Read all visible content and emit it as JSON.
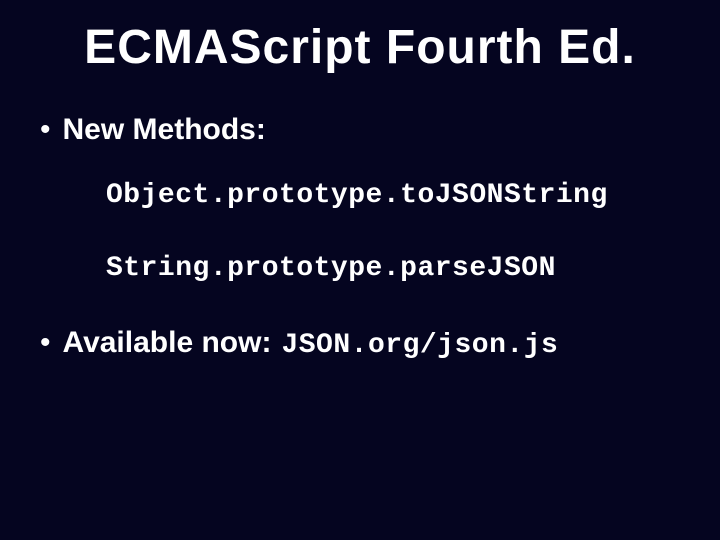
{
  "title": "ECMAScript Fourth Ed.",
  "bullets": {
    "b1": {
      "dot": "•",
      "label": "New Methods:"
    },
    "b2": {
      "dot": "•",
      "label": "Available now:",
      "code": "JSON.org/json.js"
    }
  },
  "methods": {
    "m1": "Object.prototype.toJSONString",
    "m2": "String.prototype.parseJSON"
  }
}
